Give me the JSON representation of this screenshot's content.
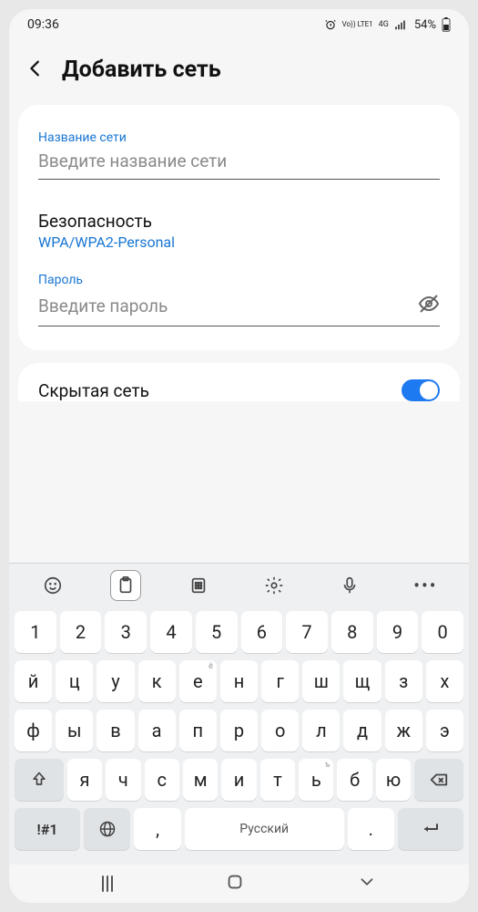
{
  "statusbar": {
    "time": "09:36",
    "alarm_icon": "alarm",
    "net1": "Vo)) LTE1",
    "net2": "4G",
    "battery_pct": "54%"
  },
  "header": {
    "title": "Добавить сеть"
  },
  "form": {
    "network_name_label": "Название сети",
    "network_name_placeholder": "Введите название сети",
    "security_label": "Безопасность",
    "security_value": "WPA/WPA2-Personal",
    "password_label": "Пароль",
    "password_placeholder": "Введите пароль",
    "hidden_label": "Скрытая сеть",
    "hidden_on": true
  },
  "keyboard": {
    "row_num": [
      "1",
      "2",
      "3",
      "4",
      "5",
      "6",
      "7",
      "8",
      "9",
      "0"
    ],
    "row1": [
      "й",
      "ц",
      "у",
      "к",
      "е",
      "н",
      "г",
      "ш",
      "щ",
      "з",
      "х"
    ],
    "row1_sup": {
      "4": "ё"
    },
    "row2": [
      "ф",
      "ы",
      "в",
      "а",
      "п",
      "р",
      "о",
      "л",
      "д",
      "ж",
      "э"
    ],
    "row3": [
      "я",
      "ч",
      "с",
      "м",
      "и",
      "т",
      "ь",
      "б",
      "ю"
    ],
    "row3_sup": {
      "6": "ъ"
    },
    "sym_key": "!#1",
    "comma_key": ",",
    "space_label": "Русский",
    "dot_key": "."
  }
}
